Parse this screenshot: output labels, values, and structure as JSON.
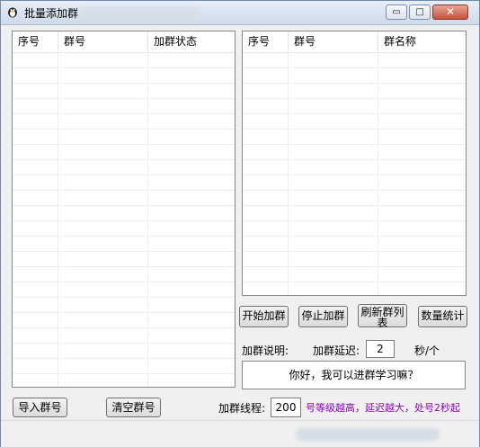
{
  "window": {
    "title": "批量添加群",
    "controls": {
      "minimize": "▭",
      "maximize": "□",
      "close": "✕"
    }
  },
  "left_list": {
    "columns": [
      "序号",
      "群号",
      "加群状态"
    ]
  },
  "right_list": {
    "columns": [
      "序号",
      "群号",
      "群名称"
    ]
  },
  "buttons": {
    "start": "开始加群",
    "stop": "停止加群",
    "refresh": "刷新群列表",
    "stats": "数量统计",
    "import": "导入群号",
    "clear": "清空群号"
  },
  "settings": {
    "desc_label": "加群说明:",
    "delay_label": "加群延迟:",
    "delay_value": "2",
    "delay_unit": "秒/个",
    "message": "你好，我可以进群学习嘛？",
    "threads_label": "加群线程:",
    "threads_value": "200",
    "note": "号等级越高，延迟越大，处号2秒起"
  },
  "colors": {
    "note": "#8b00c9",
    "titlebar": "#dbe5f1"
  }
}
